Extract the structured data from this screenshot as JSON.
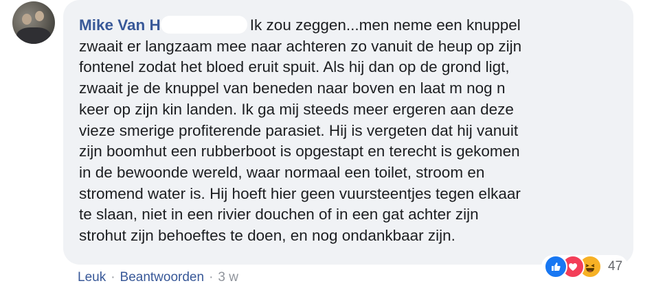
{
  "comment": {
    "author": "Mike Van H",
    "lines": [
      "Ik zou zeggen...men neme een knuppel",
      "zwaait er langzaam mee naar achteren zo vanuit de heup op zijn",
      "fontenel zodat het bloed eruit spuit. Als hij dan op de grond ligt,",
      "zwaait je de knuppel van beneden naar boven en laat m nog n",
      "keer op zijn kin landen. Ik ga mij steeds meer ergeren aan deze",
      "vieze smerige profiterende parasiet. Hij is vergeten dat hij vanuit",
      "zijn boomhut een rubberboot is opgestapt en terecht is gekomen",
      "in de bewoonde wereld, waar normaal een toilet, stroom en",
      "stromend water is. Hij hoeft hier geen vuursteentjes tegen elkaar",
      "te slaan, niet in een rivier douchen of in een gat achter zijn",
      "strohut zijn behoeftes te doen, en nog ondankbaar zijn."
    ]
  },
  "reactions": {
    "icons": [
      "like-icon",
      "love-icon",
      "haha-icon"
    ],
    "count": "47"
  },
  "actions": {
    "like_label": "Leuk",
    "reply_label": "Beantwoorden",
    "separator": "·",
    "time": "3 w"
  },
  "colors": {
    "bubble": "#f0f2f5",
    "author": "#385898",
    "like": "#1877f2",
    "love": "#f33e58",
    "haha": "#f7b125"
  }
}
